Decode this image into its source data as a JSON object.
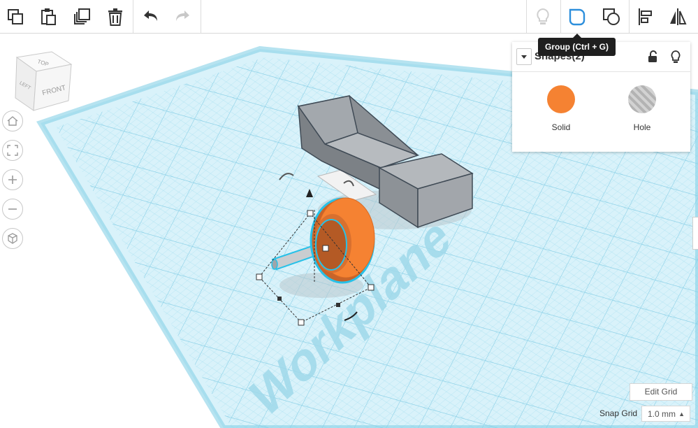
{
  "toolbar": {
    "buttons": [
      {
        "icon": "copy-icon"
      },
      {
        "icon": "paste-icon"
      },
      {
        "icon": "duplicate-icon"
      },
      {
        "icon": "trash-icon"
      },
      {
        "icon": "undo-icon"
      },
      {
        "icon": "redo-icon"
      }
    ],
    "right_buttons": [
      {
        "icon": "lightbulb-icon"
      },
      {
        "icon": "group-icon",
        "active": true
      },
      {
        "icon": "ungroup-icon"
      },
      {
        "icon": "align-icon"
      },
      {
        "icon": "mirror-icon"
      }
    ]
  },
  "tooltip": {
    "text": "Group (Ctrl + G)"
  },
  "inspector": {
    "title": "Shapes(2)",
    "options": [
      {
        "label": "Solid",
        "color": "#f58232"
      },
      {
        "label": "Hole",
        "color": "#b3b3b3"
      }
    ]
  },
  "viewcube": {
    "top": "TOP",
    "left": "LEFT",
    "front": "FRONT"
  },
  "nav": [
    "home-icon",
    "fit-view-icon",
    "zoom-in-icon",
    "zoom-out-icon",
    "perspective-icon"
  ],
  "workplane": {
    "label": "Workplane"
  },
  "grid": {
    "edit_label": "Edit Grid",
    "snap_label": "Snap Grid",
    "snap_value": "1.0 mm"
  },
  "colors": {
    "accent": "#2d8fdc",
    "grid_line": "#8fd3ea",
    "grid_fill": "#cfeef8",
    "shape_gray": "#a9adb1",
    "orange": "#f58232",
    "selection": "#27c1e8"
  }
}
